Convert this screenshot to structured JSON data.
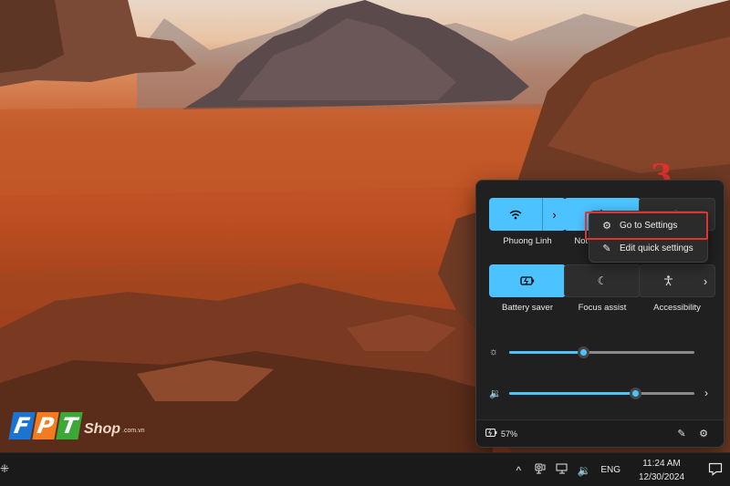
{
  "annotation": {
    "step": "3"
  },
  "branding": {
    "letters": [
      "F",
      "P",
      "T"
    ],
    "shop": "Shop",
    "domain": ".com.vn"
  },
  "quick_settings": {
    "tiles": [
      {
        "label": "Phuong Linh",
        "icon": "wifi-icon",
        "glyph": "📶",
        "active": true,
        "has_chevron": true
      },
      {
        "label": "Not connected",
        "icon": "bluetooth-icon",
        "glyph": "ᛒ",
        "active": true,
        "has_chevron": false
      },
      {
        "label": "",
        "icon": "airplane-icon",
        "glyph": "✈",
        "active": false,
        "has_chevron": false
      },
      {
        "label": "Battery saver",
        "icon": "battery-saver-icon",
        "glyph": "🔋",
        "active": true,
        "has_chevron": false
      },
      {
        "label": "Focus assist",
        "icon": "moon-icon",
        "glyph": "☾",
        "active": false,
        "has_chevron": false
      },
      {
        "label": "Accessibility",
        "icon": "accessibility-icon",
        "glyph": "♿",
        "active": false,
        "has_chevron": true
      }
    ],
    "brightness": {
      "value": 0.4,
      "icon": "brightness-icon"
    },
    "volume": {
      "value": 0.68,
      "icon": "volume-icon"
    },
    "battery_percent": "57%",
    "accent_color": "#4cc2ff"
  },
  "context_menu": {
    "items": [
      {
        "label": "Go to Settings",
        "icon": "gear-icon",
        "glyph": "⚙"
      },
      {
        "label": "Edit quick settings",
        "icon": "pencil-icon",
        "glyph": "✎"
      }
    ]
  },
  "taskbar": {
    "language": "ENG",
    "time": "11:24 AM",
    "date": "12/30/2024"
  }
}
